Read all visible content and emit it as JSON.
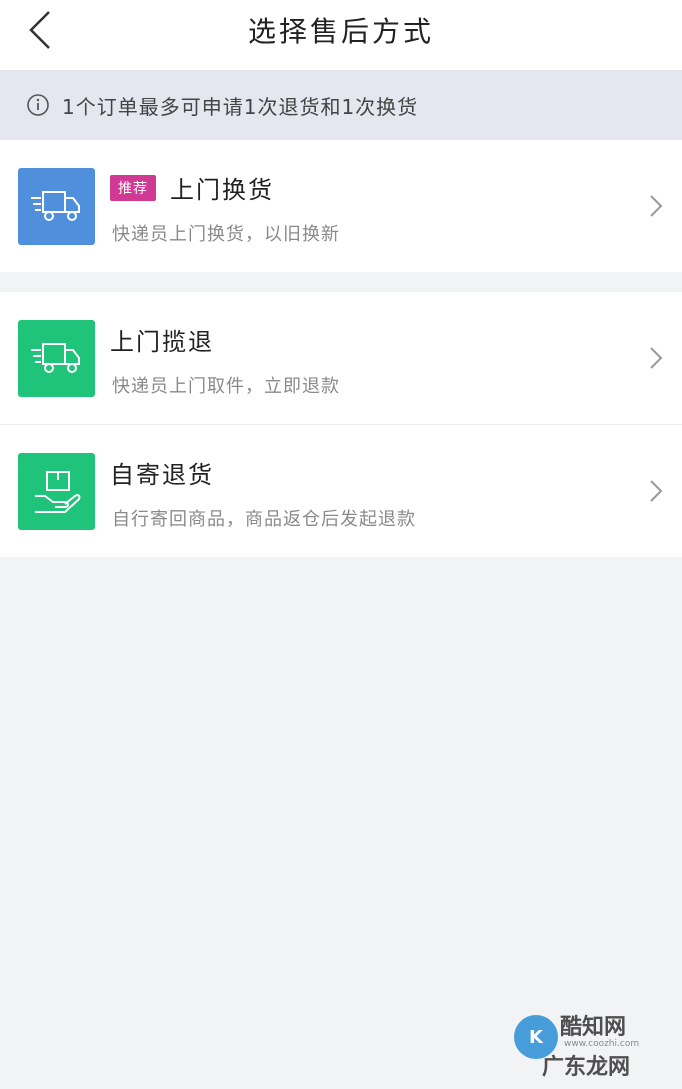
{
  "header": {
    "title": "选择售后方式",
    "back_icon": "back-icon"
  },
  "notice": {
    "icon": "info-icon",
    "text": "1个订单最多可申请1次退货和1次换货"
  },
  "options": [
    {
      "badge": "推荐",
      "title": "上门换货",
      "subtitle": "快递员上门换货，以旧换新",
      "icon": "delivery-truck-icon",
      "icon_color": "#4f8fdc"
    },
    {
      "title": "上门揽退",
      "subtitle": "快递员上门取件，立即退款",
      "icon": "delivery-truck-icon",
      "icon_color": "#1fc37a"
    },
    {
      "title": "自寄退货",
      "subtitle": "自行寄回商品，商品返仓后发起退款",
      "icon": "package-hand-icon",
      "icon_color": "#1fc37a"
    }
  ],
  "watermark": {
    "top": "酷知网",
    "url": "www.coozhi.com",
    "bottom": "广东龙网"
  }
}
